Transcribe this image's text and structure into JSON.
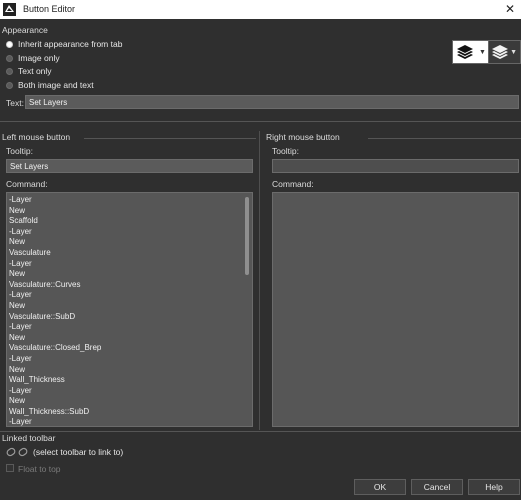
{
  "window": {
    "title": "Button Editor",
    "close_glyph": "✕"
  },
  "appearance": {
    "section_label": "Appearance",
    "options": [
      {
        "label": "Inherit appearance from tab",
        "selected": true
      },
      {
        "label": "Image only",
        "selected": false
      },
      {
        "label": "Text only",
        "selected": false
      },
      {
        "label": "Both image and text",
        "selected": false
      }
    ],
    "icon_large": "layers-icon",
    "icon_small": "layers-icon",
    "dropdown_glyph": "▼"
  },
  "text_field": {
    "label": "Text:",
    "value": "Set Layers"
  },
  "left_mouse": {
    "section_label": "Left mouse button",
    "tooltip_label": "Tooltip:",
    "tooltip_value": "Set Layers",
    "command_label": "Command:",
    "command_lines": [
      "-Layer",
      "New",
      "Scaffold",
      "-Layer",
      "New",
      "Vasculature",
      "-Layer",
      "New",
      "Vasculature::Curves",
      "-Layer",
      "New",
      "Vasculature::SubD",
      "-Layer",
      "New",
      "Vasculature::Closed_Brep",
      "-Layer",
      "New",
      "Wall_Thickness",
      "-Layer",
      "New",
      "Wall_Thickness::SubD",
      "-Layer"
    ]
  },
  "right_mouse": {
    "section_label": "Right mouse button",
    "tooltip_label": "Tooltip:",
    "tooltip_value": "",
    "command_label": "Command:",
    "command_lines": []
  },
  "linked_toolbar": {
    "section_label": "Linked toolbar",
    "link_text": "(select toolbar to link to)",
    "float_label": "Float to top",
    "float_checked": false
  },
  "footer": {
    "ok_label": "OK",
    "cancel_label": "Cancel",
    "help_label": "Help"
  }
}
